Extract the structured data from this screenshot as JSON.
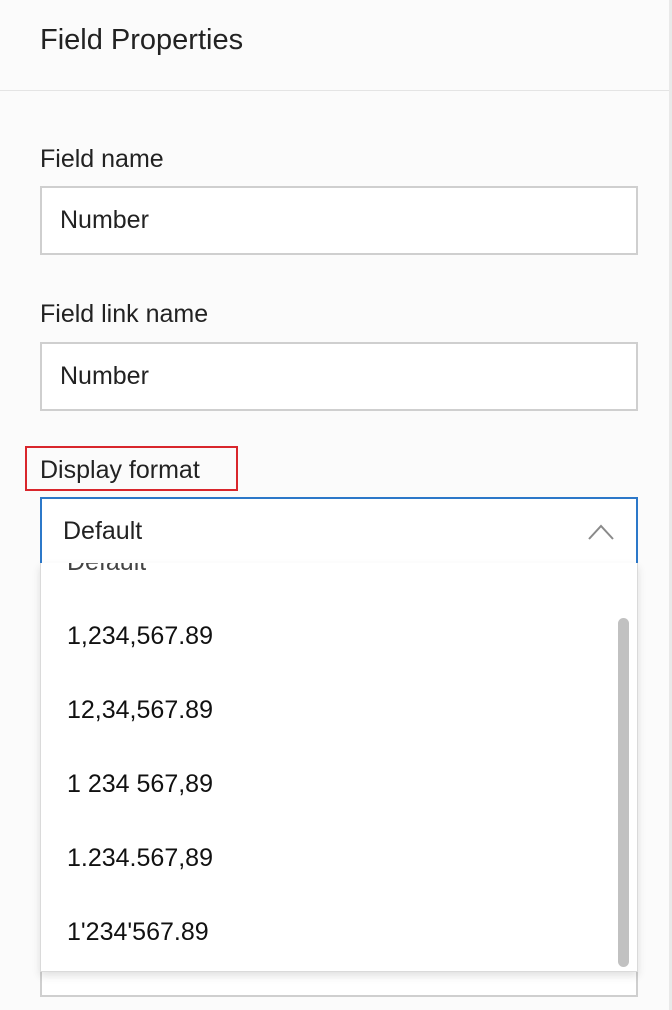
{
  "panel": {
    "title": "Field Properties"
  },
  "field_name": {
    "label": "Field name",
    "value": "Number"
  },
  "field_link_name": {
    "label": "Field link name",
    "value": "Number"
  },
  "display_format": {
    "label": "Display format",
    "selected": "Default",
    "options": [
      "Default",
      "1,234,567.89",
      "12,34,567.89",
      "1 234 567,89",
      "1.234.567,89",
      "1'234'567.89"
    ]
  },
  "colors": {
    "highlight": "#d9262c",
    "focus_border": "#2c78c9"
  },
  "icons": {
    "dropdown_toggle": "chevron-up-icon"
  }
}
